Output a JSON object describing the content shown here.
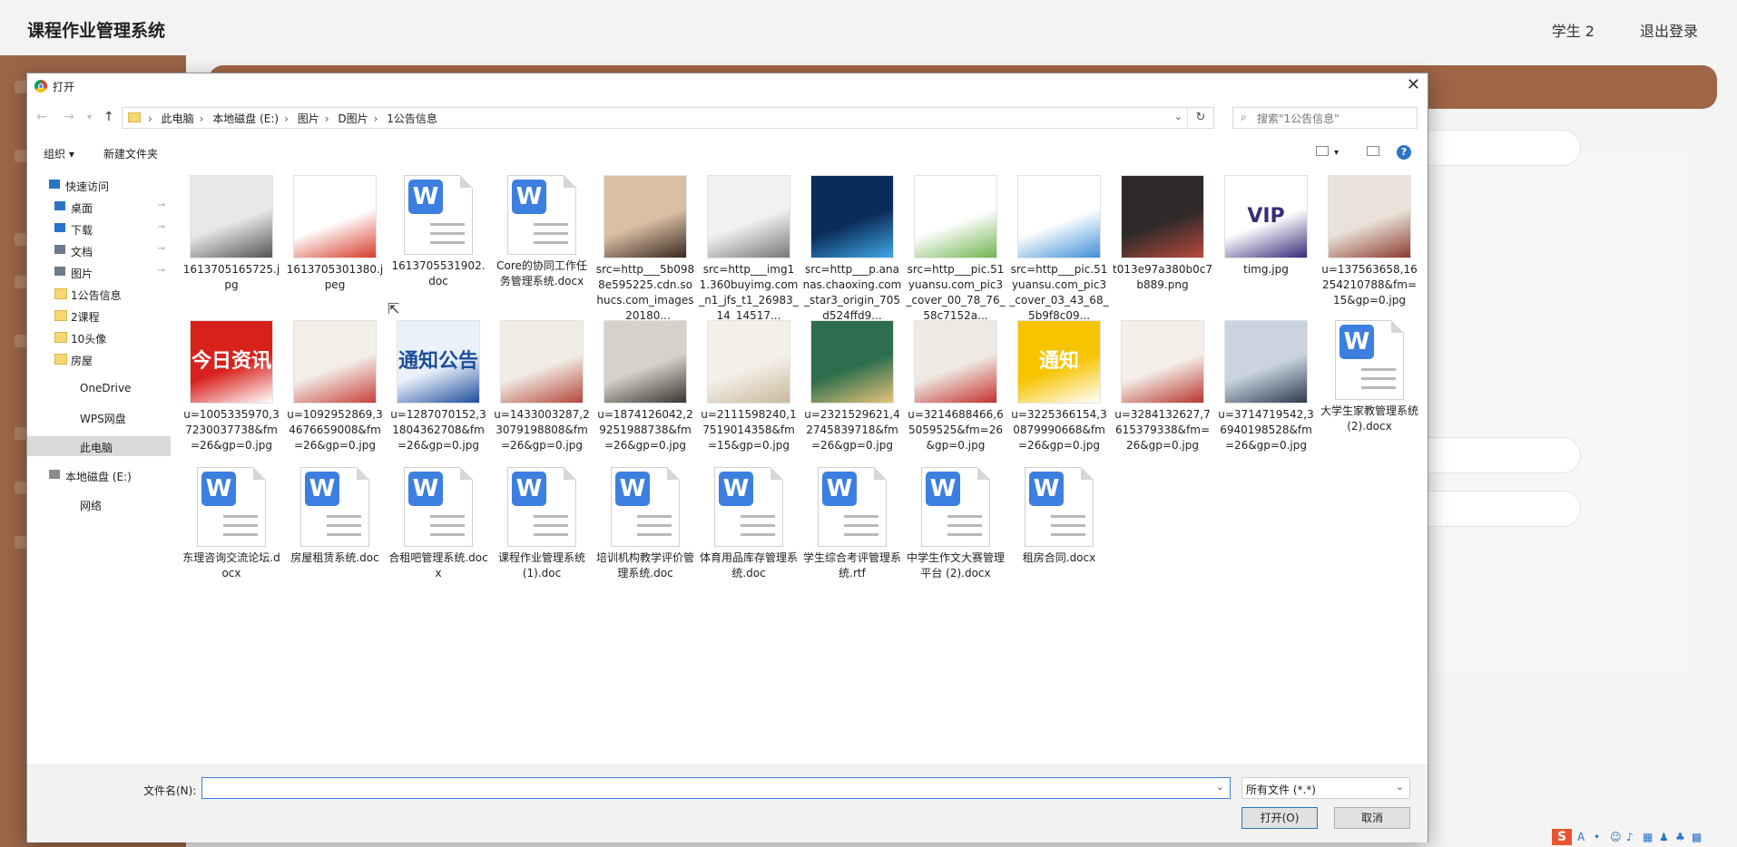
{
  "app": {
    "title": "课程作业管理系统",
    "user": "学生 2",
    "logout": "退出登录"
  },
  "dialog": {
    "title": "打开",
    "breadcrumb": [
      "此电脑",
      "本地磁盘 (E:)",
      "图片",
      "D图片",
      "1公告信息"
    ],
    "search_placeholder": "搜索\"1公告信息\"",
    "toolbar": {
      "organize": "组织 ▾",
      "new_folder": "新建文件夹"
    },
    "nav": [
      {
        "label": "快速访问",
        "icon": "star-icon",
        "pinned": false
      },
      {
        "label": "桌面",
        "icon": "desktop-icon",
        "pinned": true
      },
      {
        "label": "下载",
        "icon": "download-icon",
        "pinned": true
      },
      {
        "label": "文档",
        "icon": "document-icon",
        "pinned": true
      },
      {
        "label": "图片",
        "icon": "pictures-icon",
        "pinned": true
      },
      {
        "label": "1公告信息",
        "icon": "folder-icon",
        "pinned": false
      },
      {
        "label": "2课程",
        "icon": "folder-icon",
        "pinned": false
      },
      {
        "label": "10头像",
        "icon": "folder-icon",
        "pinned": false
      },
      {
        "label": "房屋",
        "icon": "folder-icon",
        "pinned": false
      },
      {
        "label": "OneDrive",
        "icon": "cloud-icon",
        "pinned": false
      },
      {
        "label": "WPS网盘",
        "icon": "cloud-icon",
        "pinned": false
      },
      {
        "label": "此电脑",
        "icon": "computer-icon",
        "pinned": false,
        "selected": true
      },
      {
        "label": "本地磁盘 (E:)",
        "icon": "drive-icon",
        "pinned": false
      },
      {
        "label": "网络",
        "icon": "network-icon",
        "pinned": false
      }
    ],
    "files": [
      {
        "name": "1613705165725.jpg",
        "kind": "image",
        "colors": [
          "#e8e8e8",
          "#555555"
        ]
      },
      {
        "name": "1613705301380.jpeg",
        "kind": "image",
        "colors": [
          "#ffffff",
          "#d63b2a"
        ]
      },
      {
        "name": "1613705531902.doc",
        "kind": "doc"
      },
      {
        "name": "Core的协同工作任务管理系统.docx",
        "kind": "doc"
      },
      {
        "name": "src=http___5b0988e595225.cdn.sohucs.com_images_20180...",
        "kind": "image",
        "colors": [
          "#d9bfa3",
          "#3a2a22"
        ]
      },
      {
        "name": "src=http___img11.360buyimg.com_n1_jfs_t1_26983_14_14517...",
        "kind": "image",
        "colors": [
          "#f1f1f1",
          "#777777"
        ]
      },
      {
        "name": "src=http___p.ananas.chaoxing.com_star3_origin_705d524ffd9...",
        "kind": "image",
        "colors": [
          "#0b2c5a",
          "#3fa8e6"
        ]
      },
      {
        "name": "src=http___pic.51yuansu.com_pic3_cover_00_78_76_58c7152a...",
        "kind": "image",
        "colors": [
          "#ffffff",
          "#6fb44f"
        ]
      },
      {
        "name": "src=http___pic.51yuansu.com_pic3_cover_03_43_68_5b9f8c09...",
        "kind": "image",
        "colors": [
          "#ffffff",
          "#3f8fd6"
        ]
      },
      {
        "name": "t013e97a380b0c7b889.png",
        "kind": "image",
        "colors": [
          "#2f2a2a",
          "#b84a3c"
        ]
      },
      {
        "name": "timg.jpg",
        "kind": "image",
        "colors": [
          "#ffffff",
          "#3b2a7a"
        ],
        "text": "VIP"
      },
      {
        "name": "u=137563658,16254210788&fm=15&gp=0.jpg",
        "kind": "image",
        "colors": [
          "#e9e2d8",
          "#8d3b2f"
        ]
      },
      {
        "name": "u=1005335970,37230037738&fm=26&gp=0.jpg",
        "kind": "image",
        "colors": [
          "#d9211c",
          "#ffffff"
        ],
        "text": "今日资讯"
      },
      {
        "name": "u=1092952869,34676659008&fm=26&gp=0.jpg",
        "kind": "image",
        "colors": [
          "#f3eee8",
          "#c8403a"
        ]
      },
      {
        "name": "u=1287070152,31804362708&fm=26&gp=0.jpg",
        "kind": "image",
        "colors": [
          "#eaf1fb",
          "#1e4e9c"
        ],
        "text": "通知公告"
      },
      {
        "name": "u=1433003287,23079198808&fm=26&gp=0.jpg",
        "kind": "image",
        "colors": [
          "#f1ede6",
          "#b6473b"
        ]
      },
      {
        "name": "u=1874126042,29251988738&fm=26&gp=0.jpg",
        "kind": "image",
        "colors": [
          "#d7d1cb",
          "#3a3530"
        ]
      },
      {
        "name": "u=2111598240,17519014358&fm=15&gp=0.jpg",
        "kind": "image",
        "colors": [
          "#f4f0e8",
          "#c9b89b"
        ]
      },
      {
        "name": "u=2321529621,42745839718&fm=26&gp=0.jpg",
        "kind": "image",
        "colors": [
          "#2d6f4d",
          "#e8c27a"
        ]
      },
      {
        "name": "u=3214688466,65059525&fm=26&gp=0.jpg",
        "kind": "image",
        "colors": [
          "#efe9e3",
          "#c5312c"
        ]
      },
      {
        "name": "u=3225366154,30879990668&fm=26&gp=0.jpg",
        "kind": "image",
        "colors": [
          "#f7c400",
          "#ffffff"
        ],
        "text": "通知"
      },
      {
        "name": "u=3284132627,7615379338&fm=26&gp=0.jpg",
        "kind": "image",
        "colors": [
          "#f4efe9",
          "#b8362e"
        ]
      },
      {
        "name": "u=3714719542,36940198528&fm=26&gp=0.jpg",
        "kind": "image",
        "colors": [
          "#c9d4e0",
          "#2d3b4f"
        ]
      },
      {
        "name": "大学生家教管理系统 (2).docx",
        "kind": "doc"
      },
      {
        "name": "东理咨询交流论坛.docx",
        "kind": "doc"
      },
      {
        "name": "房屋租赁系统.doc",
        "kind": "doc"
      },
      {
        "name": "合租吧管理系统.docx",
        "kind": "doc"
      },
      {
        "name": "课程作业管理系统 (1).doc",
        "kind": "doc"
      },
      {
        "name": "培训机构教学评价管理系统.doc",
        "kind": "doc"
      },
      {
        "name": "体育用品库存管理系统.doc",
        "kind": "doc"
      },
      {
        "name": "学生综合考评管理系统.rtf",
        "kind": "doc"
      },
      {
        "name": "中学生作文大赛管理平台 (2).docx",
        "kind": "doc"
      },
      {
        "name": "租房合同.docx",
        "kind": "doc"
      }
    ],
    "filename_label": "文件名(N):",
    "filename_value": "",
    "filetype": "所有文件 (*.*)",
    "open_button": "打开(O)",
    "cancel_button": "取消"
  }
}
